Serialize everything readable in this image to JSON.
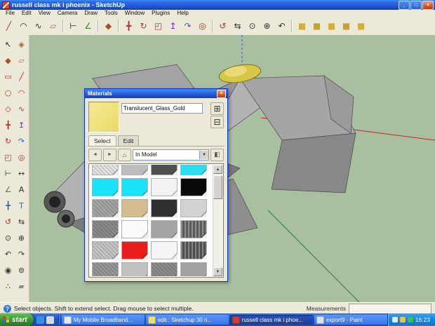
{
  "window": {
    "title": "russell class mk i phoenix - SketchUp",
    "controls": {
      "minimize": "_",
      "maximize": "□",
      "close": "×"
    }
  },
  "menu": {
    "items": [
      "File",
      "Edit",
      "View",
      "Camera",
      "Draw",
      "Tools",
      "Window",
      "Plugins",
      "Help"
    ]
  },
  "toolbar": {
    "icons": [
      {
        "name": "line-tool",
        "glyph": "╱",
        "color": "#b33325"
      },
      {
        "name": "arc-tool",
        "glyph": "◠",
        "color": "#333333"
      },
      {
        "name": "freehand-tool",
        "glyph": "∿",
        "color": "#333333"
      },
      {
        "name": "eraser-tool",
        "glyph": "▱",
        "color": "#b36655"
      },
      {
        "sep": true
      },
      {
        "name": "tape-measure-tool",
        "glyph": "⊢",
        "color": "#333333"
      },
      {
        "name": "protractor-tool",
        "glyph": "∠",
        "color": "#338833"
      },
      {
        "sep": true
      },
      {
        "name": "paint-bucket-tool",
        "glyph": "◆",
        "color": "#a05522"
      },
      {
        "sep": true
      },
      {
        "name": "move-tool",
        "glyph": "╋",
        "color": "#b33325"
      },
      {
        "name": "rotate-tool",
        "glyph": "↻",
        "color": "#b33325"
      },
      {
        "name": "scale-tool",
        "glyph": "◰",
        "color": "#b33325"
      },
      {
        "name": "push-pull-tool",
        "glyph": "↥",
        "color": "#6633bb"
      },
      {
        "name": "follow-me-tool",
        "glyph": "↷",
        "color": "#3366bb"
      },
      {
        "name": "offset-tool",
        "glyph": "◎",
        "color": "#b33325"
      },
      {
        "sep": true
      },
      {
        "name": "orbit-tool",
        "glyph": "↺",
        "color": "#b33325"
      },
      {
        "name": "pan-tool",
        "glyph": "⇆",
        "color": "#333333"
      },
      {
        "name": "zoom-tool",
        "glyph": "⊙",
        "color": "#333333"
      },
      {
        "name": "zoom-extents-tool",
        "glyph": "⊕",
        "color": "#333333"
      },
      {
        "name": "previous-view-tool",
        "glyph": "↶",
        "color": "#333333"
      },
      {
        "sep": true
      },
      {
        "name": "iso-view",
        "glyph": "■",
        "color": "#d4af37"
      },
      {
        "name": "top-view",
        "glyph": "■",
        "color": "#c9a22e"
      },
      {
        "name": "front-view",
        "glyph": "■",
        "color": "#d4af37"
      },
      {
        "name": "right-view",
        "glyph": "■",
        "color": "#c9a22e"
      },
      {
        "name": "back-view",
        "glyph": "■",
        "color": "#d4af37"
      }
    ]
  },
  "palette": {
    "icons": [
      {
        "name": "select-tool",
        "glyph": "↖",
        "color": "#222222"
      },
      {
        "name": "make-component-tool",
        "glyph": "◈",
        "color": "#996633"
      },
      {
        "name": "paint-bucket-tool",
        "glyph": "◆",
        "color": "#a05522"
      },
      {
        "name": "eraser-tool",
        "glyph": "▱",
        "color": "#b36655"
      },
      {
        "name": "rectangle-tool",
        "glyph": "▭",
        "color": "#b33325"
      },
      {
        "name": "line-tool",
        "glyph": "╱",
        "color": "#b33325"
      },
      {
        "name": "circle-tool",
        "glyph": "○",
        "color": "#b33325"
      },
      {
        "name": "arc-tool",
        "glyph": "◠",
        "color": "#b33325"
      },
      {
        "name": "polygon-tool",
        "glyph": "◇",
        "color": "#b33325"
      },
      {
        "name": "freehand-tool",
        "glyph": "∿",
        "color": "#b33325"
      },
      {
        "name": "move-tool",
        "glyph": "╋",
        "color": "#b33325"
      },
      {
        "name": "push-pull-tool",
        "glyph": "↥",
        "color": "#6633bb"
      },
      {
        "name": "rotate-tool",
        "glyph": "↻",
        "color": "#b33325"
      },
      {
        "name": "follow-me-tool",
        "glyph": "↷",
        "color": "#3366bb"
      },
      {
        "name": "scale-tool",
        "glyph": "◰",
        "color": "#b33325"
      },
      {
        "name": "offset-tool",
        "glyph": "◎",
        "color": "#b33325"
      },
      {
        "name": "tape-measure-tool",
        "glyph": "⊢",
        "color": "#333333"
      },
      {
        "name": "dimension-tool",
        "glyph": "↔",
        "color": "#333333"
      },
      {
        "name": "protractor-tool",
        "glyph": "∠",
        "color": "#338833"
      },
      {
        "name": "text-tool",
        "glyph": "A",
        "color": "#333333"
      },
      {
        "name": "axes-tool",
        "glyph": "╋",
        "color": "#3366bb"
      },
      {
        "name": "3d-text-tool",
        "glyph": "T",
        "color": "#3366bb"
      },
      {
        "name": "orbit-tool",
        "glyph": "↺",
        "color": "#b33325"
      },
      {
        "name": "pan-tool",
        "glyph": "⇆",
        "color": "#333333"
      },
      {
        "name": "zoom-tool",
        "glyph": "⊙",
        "color": "#333333"
      },
      {
        "name": "zoom-extents-tool",
        "glyph": "⊕",
        "color": "#333333"
      },
      {
        "name": "previous-view-tool",
        "glyph": "↶",
        "color": "#333333"
      },
      {
        "name": "next-view-tool",
        "glyph": "↷",
        "color": "#333333"
      },
      {
        "name": "position-camera-tool",
        "glyph": "◉",
        "color": "#333333"
      },
      {
        "name": "look-around-tool",
        "glyph": "⊚",
        "color": "#333333"
      },
      {
        "name": "walk-tool",
        "glyph": "∴",
        "color": "#333333"
      },
      {
        "name": "section-plane-tool",
        "glyph": "▰",
        "color": "#888888"
      }
    ]
  },
  "materials_dialog": {
    "title": "Materials",
    "close_glyph": "×",
    "material_name": "Translucent_Glass_Gold",
    "preview_color": "#efe27e",
    "buttons": {
      "create_glyph": "⊞",
      "secondary_glyph": "⊟"
    },
    "tabs": [
      {
        "label": "Select"
      },
      {
        "label": "Edit"
      }
    ],
    "nav": {
      "back": "◄",
      "forward": "►",
      "home": "⌂",
      "dropdown_value": "In Model",
      "dropdown_arrow": "▼",
      "sample_glyph": "◧"
    },
    "scrollbar": {
      "up": "▲",
      "down": "▼"
    },
    "swatches": [
      {
        "color": "#e6e6e6",
        "textured": true
      },
      {
        "color": "#bdbdbd"
      },
      {
        "color": "#4f4f4f"
      },
      {
        "color": "#29dff2"
      },
      {
        "color": "#18e3f8"
      },
      {
        "color": "#18e3f8"
      },
      {
        "color": "#f2f2f2"
      },
      {
        "color": "#0a0a0a"
      },
      {
        "color": "#a8a8a8",
        "textured": true
      },
      {
        "color": "#d5bc8e"
      },
      {
        "color": "#303030"
      },
      {
        "color": "#d2d2d2"
      },
      {
        "color": "#8d8d8d",
        "textured": true
      },
      {
        "color": "#fafafa"
      },
      {
        "color": "#a4a4a4"
      },
      {
        "color": "#5c5c5c",
        "striped": true
      },
      {
        "color": "#c8c8c8",
        "textured": true
      },
      {
        "color": "#e81c1c"
      },
      {
        "color": "#f5f5f5"
      },
      {
        "color": "#4e4e4e",
        "striped": true
      },
      {
        "color": "#9a9a9a",
        "textured": true
      },
      {
        "color": "#c0c0c0"
      },
      {
        "color": "#8e8e8e",
        "textured": true
      },
      {
        "color": "#a1a1a1"
      }
    ]
  },
  "status_bar": {
    "help_glyph": "?",
    "message": "Select objects. Shift to extend select. Drag mouse to select multiple.",
    "measurements_label": "Measurements"
  },
  "taskbar": {
    "start_label": "start",
    "tasks": [
      {
        "label": "My Mobile Broadband...",
        "icon_color": "#e8e8e8"
      },
      {
        "label": "edit : Sketchup 30 n...",
        "icon_color": "#f4e05a"
      },
      {
        "label": "russell class mk i phoe...",
        "icon_color": "#d43b2a",
        "active": true
      },
      {
        "label": "export9 - Paint",
        "icon_color": "#e0e0e0"
      }
    ],
    "time": "16:23"
  }
}
